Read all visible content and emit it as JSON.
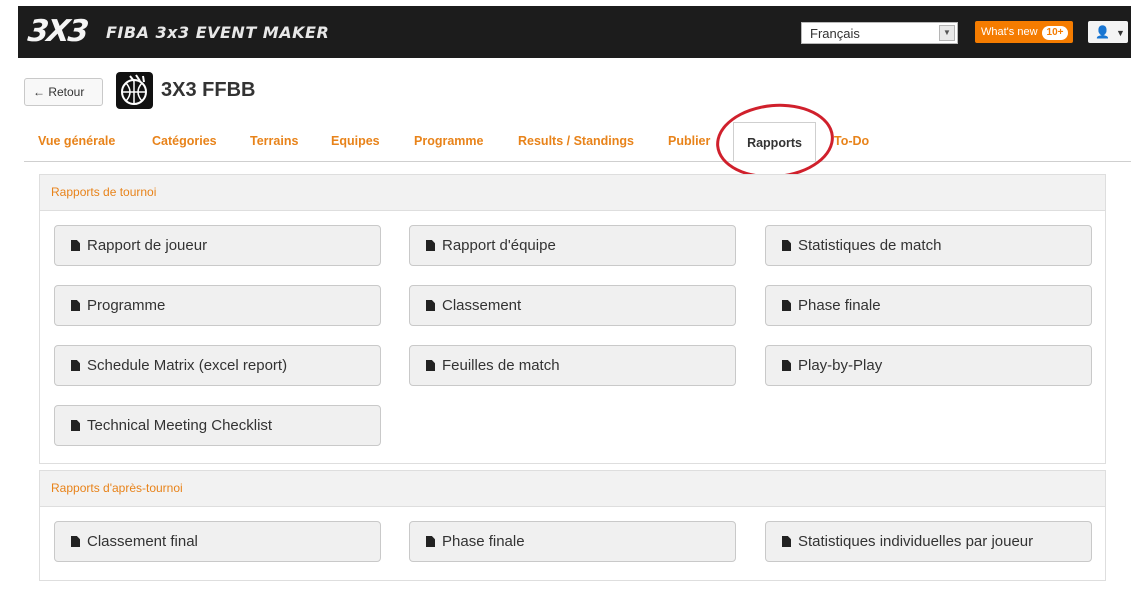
{
  "header": {
    "logo": "3X3",
    "app_title": "FIBA 3x3 EVENT MAKER",
    "language": "Français",
    "whats_new": "What's new",
    "whats_new_count": "10+"
  },
  "event": {
    "back_label": "← Retour",
    "title": "3X3 FFBB"
  },
  "tabs": [
    {
      "label": "Vue générale"
    },
    {
      "label": "Catégories"
    },
    {
      "label": "Terrains"
    },
    {
      "label": "Equipes"
    },
    {
      "label": "Programme"
    },
    {
      "label": "Results / Standings"
    },
    {
      "label": "Publier"
    },
    {
      "label": "Rapports",
      "active": true
    },
    {
      "label": "To-Do"
    }
  ],
  "sections": {
    "tournoi": {
      "title": "Rapports de tournoi",
      "reports": [
        "Rapport de joueur",
        "Rapport d'équipe",
        "Statistiques de match",
        "Programme",
        "Classement",
        "Phase finale",
        "Schedule Matrix (excel report)",
        "Feuilles de match",
        "Play-by-Play",
        "Technical Meeting Checklist"
      ]
    },
    "apres": {
      "title": "Rapports d'après-tournoi",
      "reports": [
        "Classement final",
        "Phase finale",
        "Statistiques individuelles par joueur"
      ]
    }
  },
  "colors": {
    "accent": "#e8831a",
    "header_bg": "#1c1c1c",
    "whats_new_bg": "#f57c00",
    "highlight_circle": "#d0202c"
  }
}
